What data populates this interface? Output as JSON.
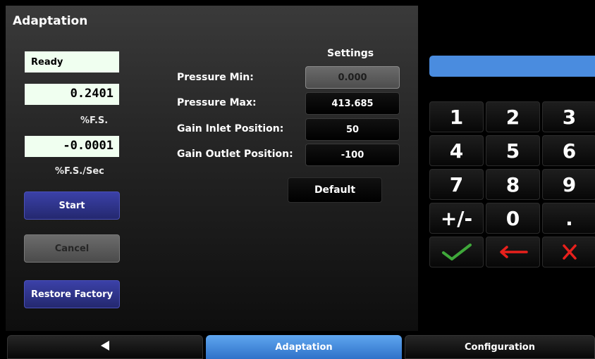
{
  "page": {
    "title": "Adaptation"
  },
  "status": {
    "text": "Ready"
  },
  "readings": [
    {
      "value": "0.2401",
      "unit": "%F.S."
    },
    {
      "value": "-0.0001",
      "unit": "%F.S./Sec"
    }
  ],
  "buttons": {
    "start": "Start",
    "cancel": "Cancel",
    "restore_factory": "Restore Factory",
    "default": "Default"
  },
  "settings": {
    "heading": "Settings",
    "rows": [
      {
        "label": "Pressure Min:",
        "value": "0.000",
        "active": true
      },
      {
        "label": "Pressure Max:",
        "value": "413.685",
        "active": false
      },
      {
        "label": "Gain Inlet Position:",
        "value": "50",
        "active": false
      },
      {
        "label": "Gain Outlet Position:",
        "value": "-100",
        "active": false
      }
    ]
  },
  "keypad": {
    "display_value": "",
    "keys": [
      "1",
      "2",
      "3",
      "4",
      "5",
      "6",
      "7",
      "8",
      "9",
      "+/-",
      "0",
      "."
    ],
    "icons": {
      "enter": "checkmark-icon",
      "backspace": "left-arrow-icon",
      "clear": "x-icon"
    },
    "colors": {
      "enter": "#3fa83a",
      "backspace": "#e8201c",
      "clear": "#e8201c",
      "display": "#4a8cdf"
    }
  },
  "bottom_tabs": {
    "back_icon": "back-arrow-icon",
    "active": "Adaptation",
    "right": "Configuration"
  }
}
